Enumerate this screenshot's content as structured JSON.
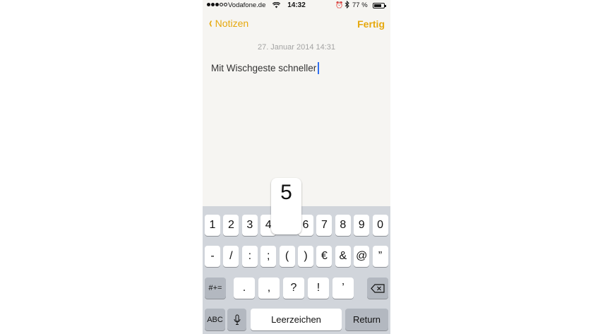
{
  "status_bar": {
    "carrier": "Vodafone.de",
    "time": "14:32",
    "battery_percent": "77 %",
    "battery_level": 0.77,
    "signal_bars": 3,
    "signal_total": 5
  },
  "nav": {
    "back_label": "Notizen",
    "done_label": "Fertig"
  },
  "note": {
    "date": "27. Januar 2014 14:31",
    "text": "Mit Wischgeste schneller"
  },
  "keyboard": {
    "popup_key": "5",
    "row1": [
      "1",
      "2",
      "3",
      "4",
      "5",
      "6",
      "7",
      "8",
      "9",
      "0"
    ],
    "row2": [
      "-",
      "/",
      ":",
      ";",
      "(",
      ")",
      "€",
      "&",
      "@",
      "”"
    ],
    "row3_mode": "#+=",
    "row3": [
      ".",
      ",",
      "?",
      "!",
      "’"
    ],
    "abc": "ABC",
    "space": "Leerzeichen",
    "return": "Return"
  },
  "colors": {
    "accent": "#e6a80c",
    "cursor": "#2f6ff0",
    "paper": "#f6f5f2",
    "keyboard_bg": "#d1d5db"
  }
}
